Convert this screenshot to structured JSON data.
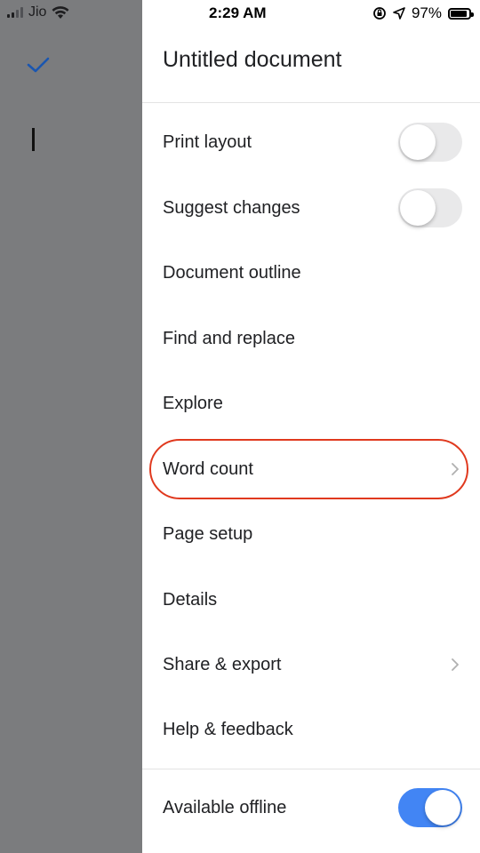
{
  "status_bar": {
    "carrier": "Jio",
    "time": "2:29 AM",
    "battery_percent": "97%",
    "icons": [
      "signal-bars-icon",
      "wifi-icon",
      "orientation-lock-icon",
      "location-arrow-icon",
      "battery-icon"
    ]
  },
  "document": {
    "title": "Untitled document"
  },
  "menu": {
    "items": [
      {
        "label": "Print layout",
        "control": "toggle",
        "on": false
      },
      {
        "label": "Suggest changes",
        "control": "toggle",
        "on": false
      },
      {
        "label": "Document outline"
      },
      {
        "label": "Find and replace"
      },
      {
        "label": "Explore"
      },
      {
        "label": "Word count",
        "control": "chevron",
        "highlighted": true
      },
      {
        "label": "Page setup"
      },
      {
        "label": "Details"
      },
      {
        "label": "Share & export",
        "control": "chevron"
      },
      {
        "label": "Help & feedback"
      },
      {
        "label": "Available offline",
        "control": "toggle",
        "on": true
      }
    ]
  },
  "colors": {
    "accent": "#4285f4",
    "highlight_ring": "#e0391e",
    "checkmark": "#1a56b0",
    "overlay": "#7b7c7e"
  }
}
